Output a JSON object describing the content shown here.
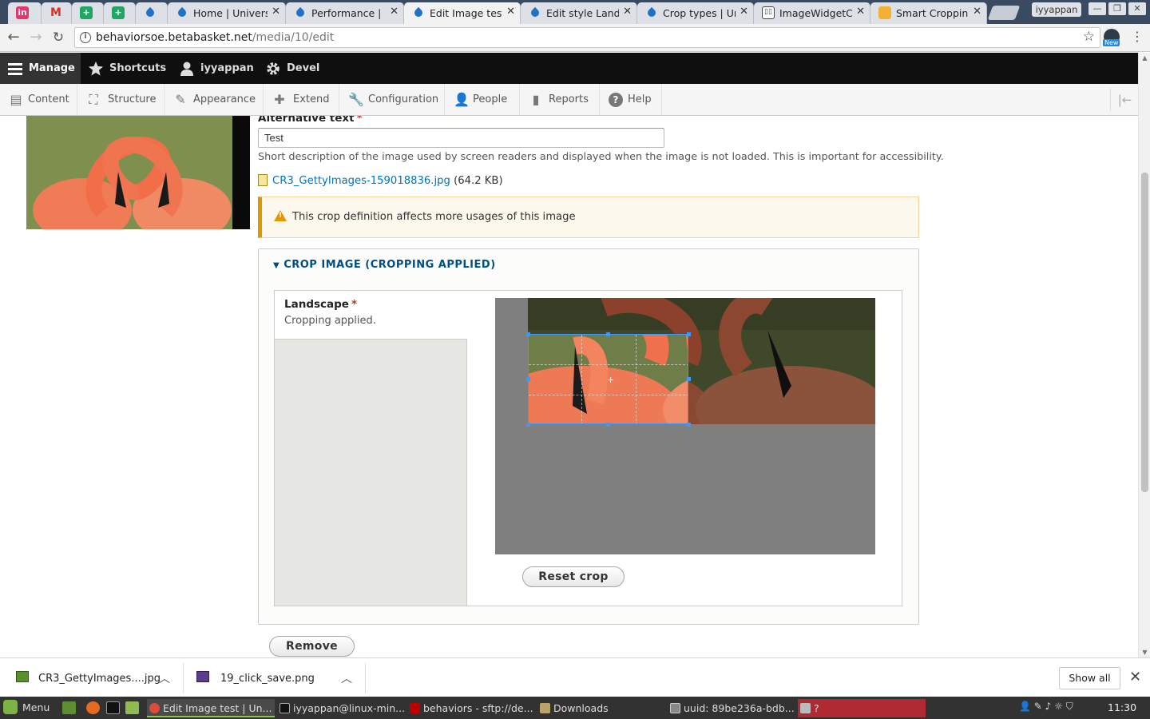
{
  "browser": {
    "tabs": [
      {
        "title": "",
        "favicon": "invision-icon"
      },
      {
        "title": "",
        "favicon": "gmail-icon"
      },
      {
        "title": "",
        "favicon": "sheets-plus-icon"
      },
      {
        "title": "",
        "favicon": "sheets-plus-icon"
      },
      {
        "title": "",
        "favicon": "drupal-icon"
      },
      {
        "title": "Home | Univers",
        "favicon": "drupal-icon"
      },
      {
        "title": "Performance |",
        "favicon": "drupal-icon"
      },
      {
        "title": "Edit Image test",
        "favicon": "drupal-icon",
        "active": true
      },
      {
        "title": "Edit style Lands",
        "favicon": "drupal-icon"
      },
      {
        "title": "Crop types | Ur",
        "favicon": "drupal-icon"
      },
      {
        "title": "ImageWidgetC",
        "favicon": "book-icon"
      },
      {
        "title": "Smart Cropping",
        "favicon": "bookmark-icon"
      }
    ],
    "profile": "iyyappan",
    "url_host": "behaviorsoe.betabasket.net",
    "url_path": "/media/10/edit",
    "extension_badge": "New"
  },
  "admin_toolbar": {
    "items": [
      "Manage",
      "Shortcuts",
      "iyyappan",
      "Devel"
    ],
    "tray": [
      "Content",
      "Structure",
      "Appearance",
      "Extend",
      "Configuration",
      "People",
      "Reports",
      "Help"
    ]
  },
  "form": {
    "alt_label": "Alternative text",
    "required_marker": "*",
    "alt_value": "Test",
    "alt_description": "Short description of the image used by screen readers and displayed when the image is not loaded. This is important for accessibility.",
    "file_name": "CR3_GettyImages-159018836.jpg",
    "file_size": "(64.2 KB)",
    "warning": "This crop definition affects more usages of this image",
    "crop_summary": "CROP IMAGE (CROPPING APPLIED)",
    "crop_tab_title": "Landscape",
    "crop_tab_status": "Cropping applied.",
    "reset_button": "Reset crop",
    "remove_button": "Remove"
  },
  "downloads": {
    "items": [
      "CR3_GettyImages....jpg",
      "19_click_save.png"
    ],
    "show_all": "Show all"
  },
  "taskbar": {
    "menu": "Menu",
    "tasks": [
      "Edit Image test | Un...",
      "iyyappan@linux-min...",
      "behaviors - sftp://de...",
      "Downloads",
      "uuid: 89be236a-bdb...",
      "?"
    ],
    "clock": "11:30"
  },
  "colors": {
    "drupal_link": "#0074bd",
    "warning_border": "#e09600",
    "crop_selection": "#3b99fc",
    "details_summary": "#004f80",
    "required": "#e32700"
  }
}
